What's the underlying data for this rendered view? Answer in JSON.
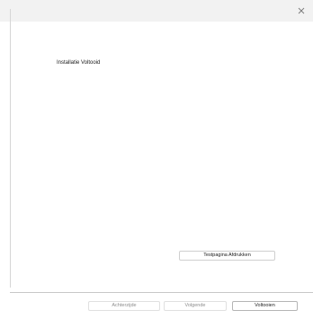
{
  "window": {
    "close_icon": "close-icon"
  },
  "content": {
    "heading": "Installatie Voltooid",
    "print_test_page_label": "Testpagina Afdrukken"
  },
  "footer": {
    "back_label": "Achterzijde",
    "next_label": "Volgende",
    "finish_label": "Voltooien"
  },
  "colors": {
    "title_bar": "#f2f2f2",
    "background": "#ffffff",
    "border": "#cfcfcf",
    "disabled_text": "#8c8c8c"
  }
}
